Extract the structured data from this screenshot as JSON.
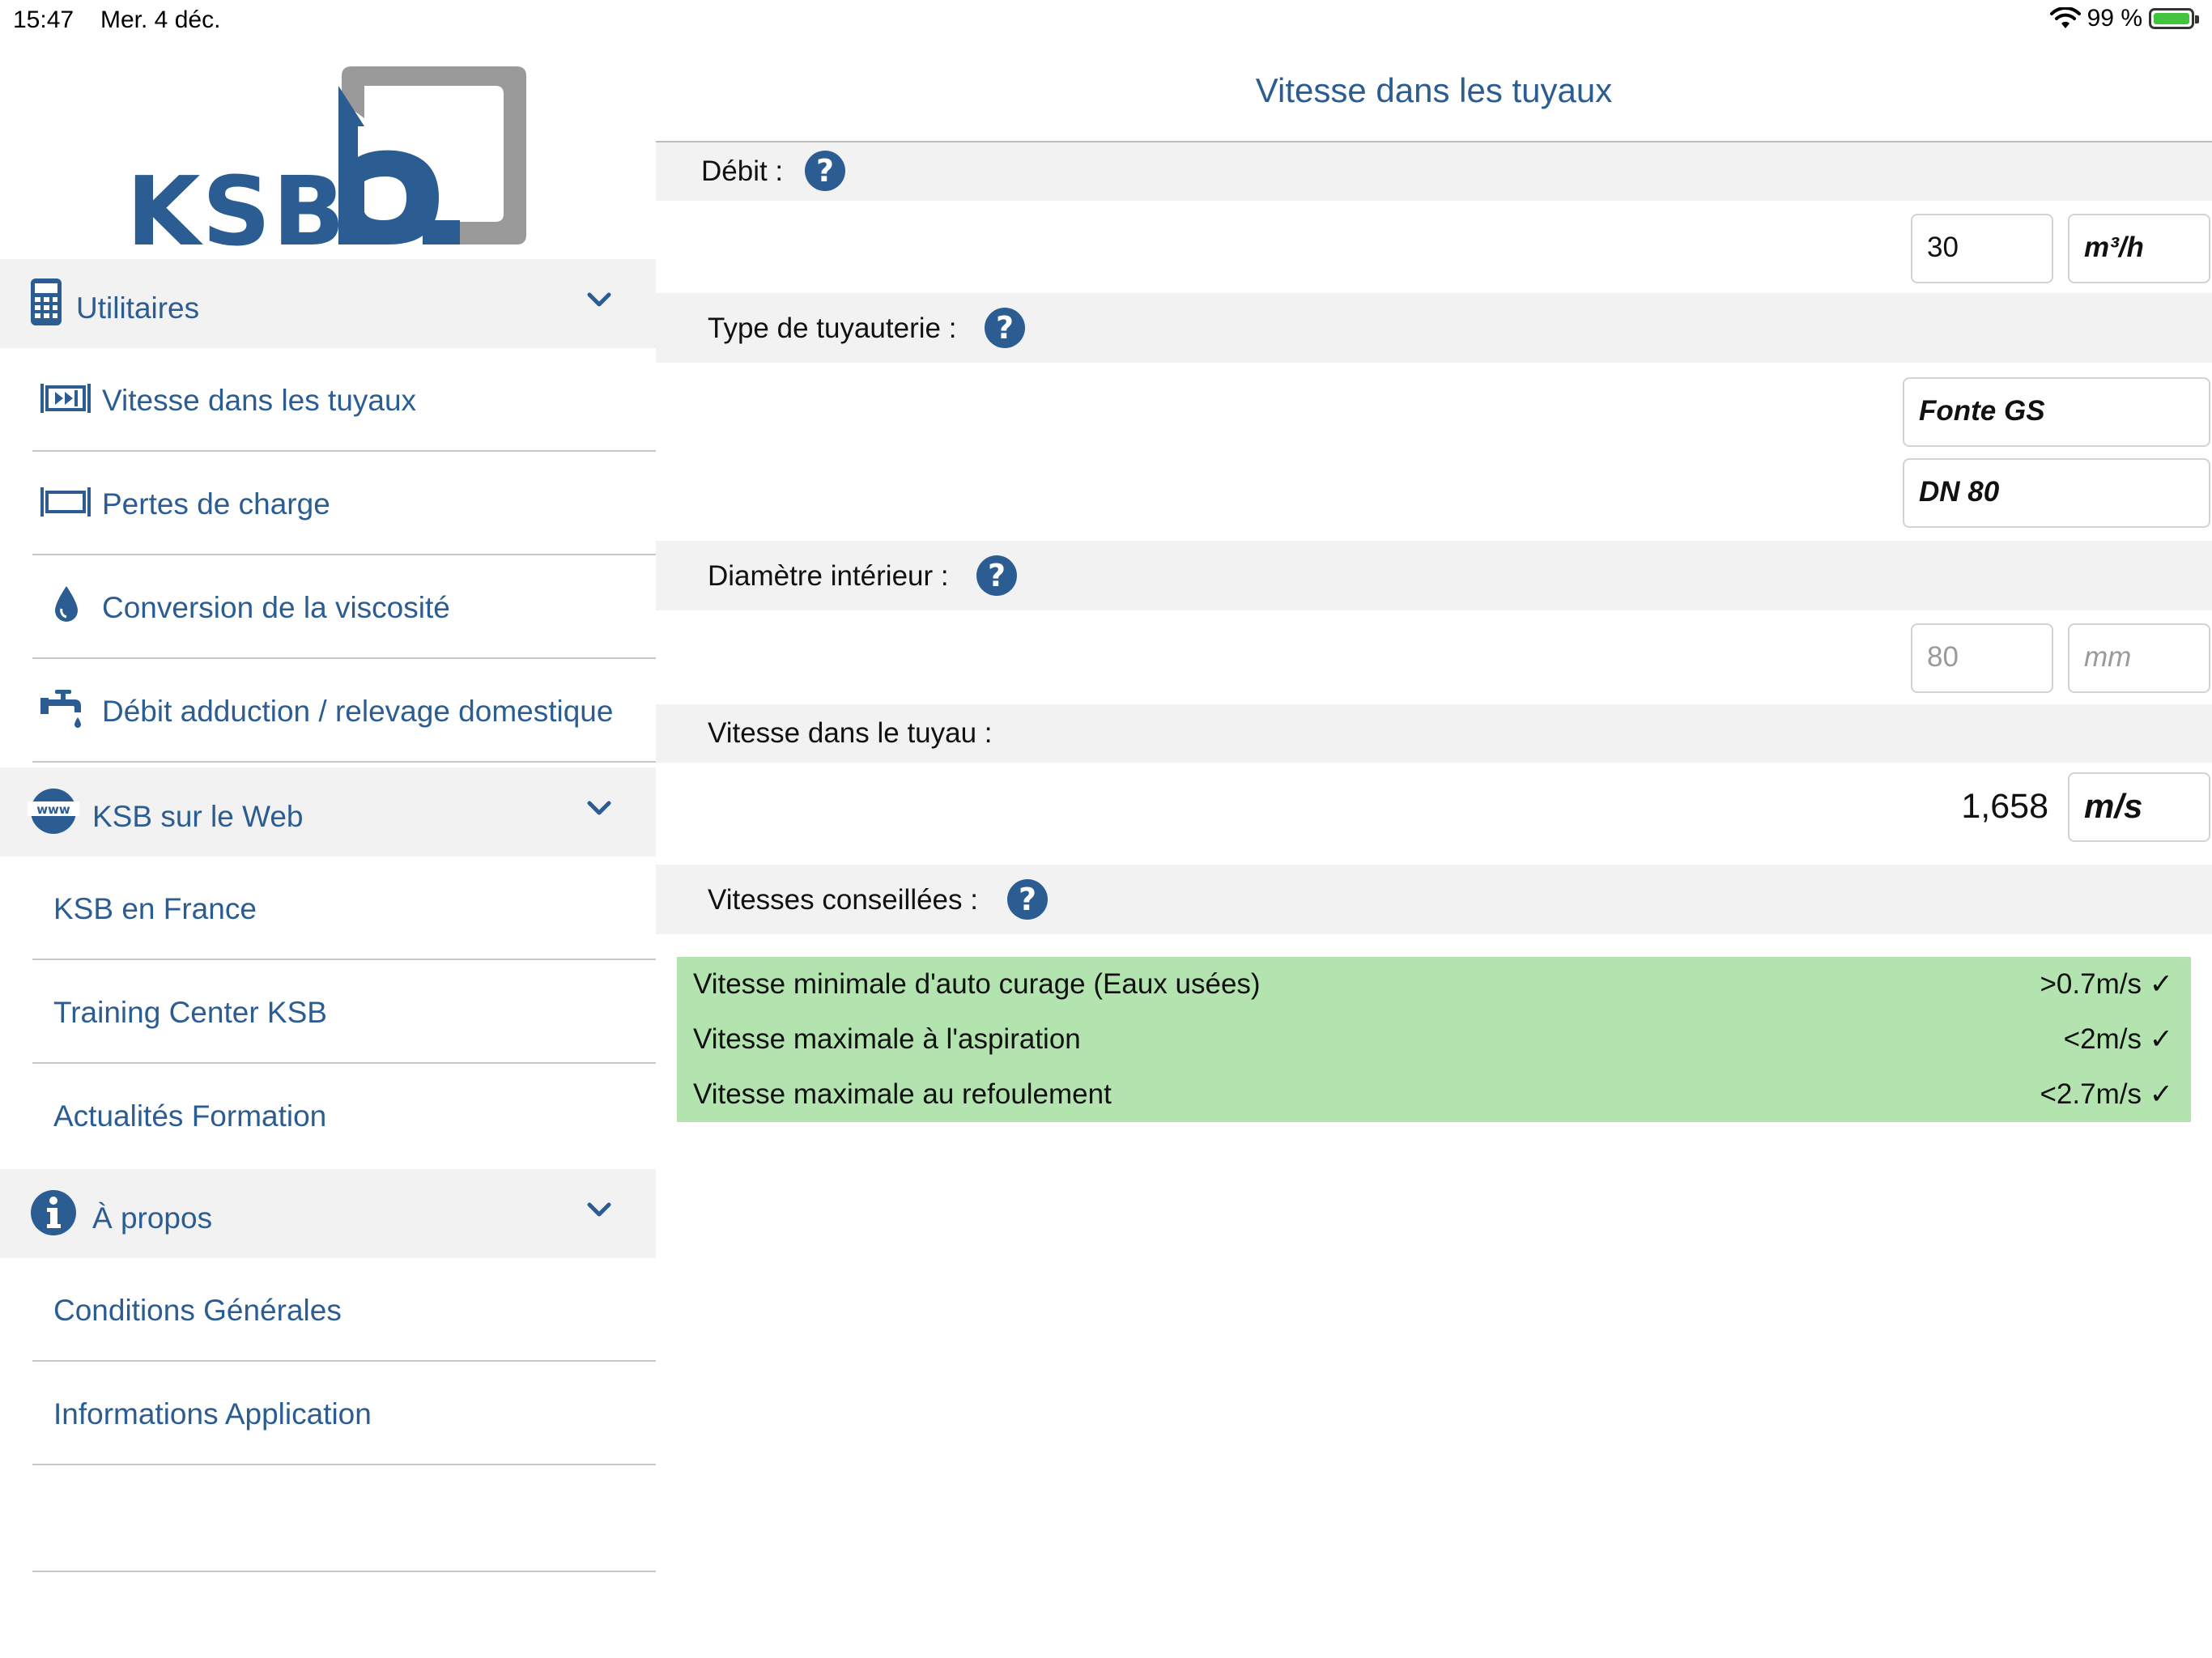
{
  "status_bar": {
    "time": "15:47",
    "date": "Mer. 4 déc.",
    "battery": "99 %",
    "battery_level": 0.99
  },
  "sidebar": {
    "logo_text": "KSB",
    "sections": [
      {
        "label": "Utilitaires",
        "icon": "calculator-icon",
        "items": [
          {
            "label": "Vitesse dans les tuyaux",
            "icon": "pipe-velocity-icon"
          },
          {
            "label": "Pertes de charge",
            "icon": "pipe-icon"
          },
          {
            "label": "Conversion de la viscosité",
            "icon": "drop-icon"
          },
          {
            "label": "Débit adduction / relevage domestique",
            "icon": "faucet-icon"
          }
        ]
      },
      {
        "label": "KSB sur le Web",
        "icon": "www-icon",
        "items": [
          {
            "label": "KSB en France"
          },
          {
            "label": "Training Center KSB"
          },
          {
            "label": "Actualités Formation"
          }
        ]
      },
      {
        "label": "À propos",
        "icon": "info-icon",
        "items": [
          {
            "label": "Conditions Générales"
          },
          {
            "label": "Informations Application"
          }
        ]
      }
    ]
  },
  "main": {
    "title": "Vitesse dans les tuyaux",
    "debit": {
      "label": "Débit :",
      "value": "30",
      "unit": "m³/h"
    },
    "pipe_type": {
      "label": "Type de tuyauterie :",
      "material": "Fonte GS",
      "nominal": "DN 80"
    },
    "inner_diameter": {
      "label": "Diamètre intérieur :",
      "value": "80",
      "unit": "mm"
    },
    "velocity": {
      "label": "Vitesse dans le tuyau :",
      "value": "1,658",
      "unit": "m/s"
    },
    "recommended": {
      "label": "Vitesses conseillées :",
      "rows": [
        {
          "label": "Vitesse minimale d'auto curage (Eaux usées)",
          "value": ">0.7m/s ✓"
        },
        {
          "label": "Vitesse maximale à l'aspiration",
          "value": "<2m/s ✓"
        },
        {
          "label": "Vitesse maximale au refoulement",
          "value": "<2.7m/s ✓"
        }
      ]
    },
    "help_symbol": "?"
  },
  "colors": {
    "brand_blue": "#2b5d93",
    "logo_gray": "#9a9a9a",
    "recommend_green": "#b3e4b0",
    "band_gray": "#f2f2f2"
  }
}
